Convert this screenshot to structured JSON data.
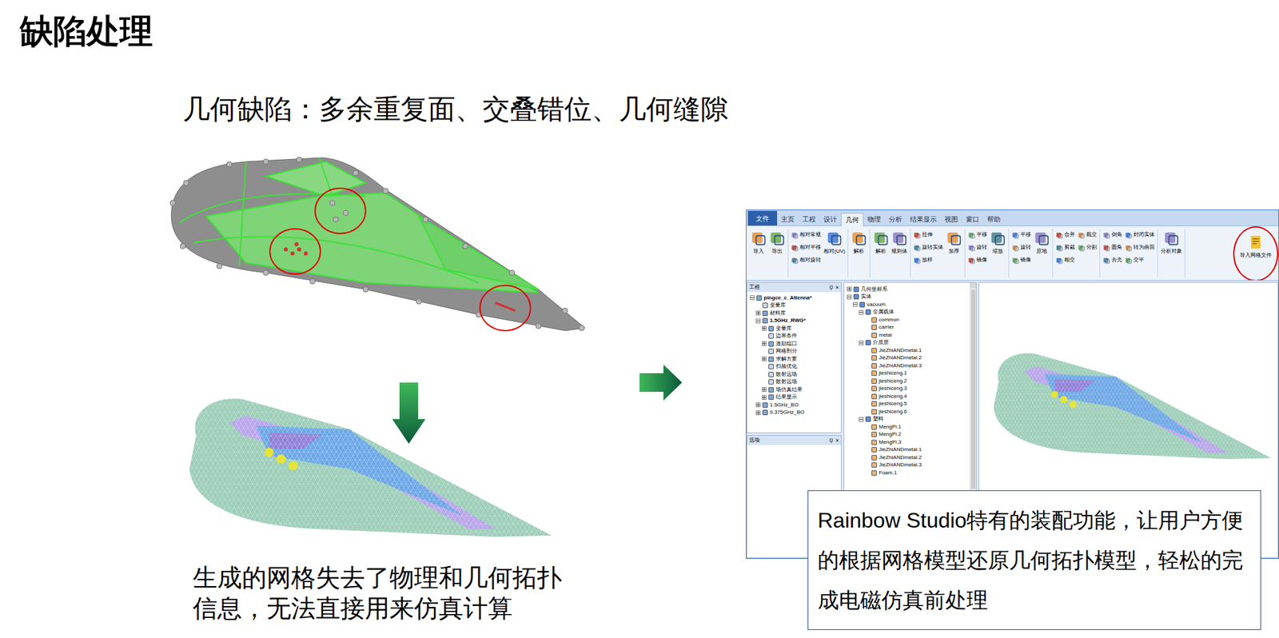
{
  "slide": {
    "title": "缺陷处理",
    "subtitle": "几何缺陷：多余重复面、交叠错位、几何缝隙",
    "caption_lines": [
      "生成的网格失去了物理和几何拓扑",
      "信息，无法直接用来仿真计算"
    ],
    "callout": "Rainbow Studio特有的装配功能，让用户方便的根据网格模型还原几何拓扑模型，轻松的完成电磁仿真前处理"
  },
  "app": {
    "tabs": [
      {
        "label": "文件",
        "kind": "file",
        "selected": false
      },
      {
        "label": "主页",
        "kind": "tab",
        "selected": false
      },
      {
        "label": "工程",
        "kind": "tab",
        "selected": false
      },
      {
        "label": "设计",
        "kind": "tab",
        "selected": false
      },
      {
        "label": "几何",
        "kind": "tab",
        "selected": true
      },
      {
        "label": "物理",
        "kind": "tab",
        "selected": false
      },
      {
        "label": "分析",
        "kind": "tab",
        "selected": false
      },
      {
        "label": "结果显示",
        "kind": "tab",
        "selected": false
      },
      {
        "label": "视图",
        "kind": "tab",
        "selected": false
      },
      {
        "label": "窗口",
        "kind": "tab",
        "selected": false
      },
      {
        "label": "帮助",
        "kind": "tab",
        "selected": false
      }
    ],
    "ribbon": [
      {
        "buttons": [
          {
            "label": "导入",
            "kind": "large"
          },
          {
            "label": "导出",
            "kind": "large"
          }
        ]
      },
      {
        "buttons": [
          {
            "label": "相对常规",
            "kind": "small"
          },
          {
            "label": "相对平移",
            "kind": "small"
          },
          {
            "label": "相对旋转",
            "kind": "small"
          },
          {
            "label": "相对(UV)",
            "kind": "large"
          }
        ]
      },
      {
        "buttons": [
          {
            "label": "解析",
            "kind": "large"
          }
        ]
      },
      {
        "buttons": [
          {
            "label": "解析",
            "kind": "large"
          },
          {
            "label": "规则体",
            "kind": "large"
          }
        ]
      },
      {
        "buttons": [
          {
            "label": "拉伸",
            "kind": "small"
          },
          {
            "label": "旋转实体",
            "kind": "small"
          },
          {
            "label": "放样",
            "kind": "small"
          },
          {
            "label": "加厚",
            "kind": "large"
          }
        ]
      },
      {
        "buttons": [
          {
            "label": "平移",
            "kind": "small"
          },
          {
            "label": "旋转",
            "kind": "small"
          },
          {
            "label": "镜像",
            "kind": "small"
          },
          {
            "label": "缩放",
            "kind": "large"
          }
        ]
      },
      {
        "buttons": [
          {
            "label": "平移",
            "kind": "small"
          },
          {
            "label": "旋转",
            "kind": "small"
          },
          {
            "label": "镜像",
            "kind": "small"
          },
          {
            "label": "原地",
            "kind": "large"
          }
        ]
      },
      {
        "buttons": [
          {
            "label": "合并",
            "kind": "small"
          },
          {
            "label": "剪裁",
            "kind": "small"
          },
          {
            "label": "相交",
            "kind": "small"
          },
          {
            "label": "截交",
            "kind": "small"
          },
          {
            "label": "分割",
            "kind": "small"
          }
        ]
      },
      {
        "buttons": [
          {
            "label": "倒角",
            "kind": "small"
          },
          {
            "label": "圆角",
            "kind": "small"
          },
          {
            "label": "去壳",
            "kind": "small"
          },
          {
            "label": "封闭实体",
            "kind": "small"
          },
          {
            "label": "转为曲面",
            "kind": "small"
          },
          {
            "label": "交平",
            "kind": "small"
          }
        ]
      },
      {
        "buttons": [
          {
            "label": "分析对象",
            "kind": "large"
          }
        ]
      }
    ],
    "import_mesh_button": {
      "label": "导入网格文件",
      "circled": true
    },
    "project_panel": {
      "title": "工程",
      "close": "×"
    },
    "options_panel": {
      "title": "选项",
      "close": "×"
    },
    "project_tree": [
      {
        "label": "pingce_c_Attenna*",
        "depth": 0,
        "kind": "folder",
        "expanded": true,
        "active": true
      },
      {
        "label": "变量库",
        "depth": 1,
        "kind": "leaf",
        "expanded": false,
        "active": false
      },
      {
        "label": "材料库",
        "depth": 1,
        "kind": "folder",
        "expanded": false,
        "active": false
      },
      {
        "label": "1.5GHz_RWG*",
        "depth": 1,
        "kind": "folder",
        "expanded": true,
        "active": true
      },
      {
        "label": "变量库",
        "depth": 2,
        "kind": "folder",
        "expanded": false,
        "active": false
      },
      {
        "label": "边界条件",
        "depth": 2,
        "kind": "leaf",
        "expanded": false,
        "active": false
      },
      {
        "label": "激励端口",
        "depth": 2,
        "kind": "folder",
        "expanded": false,
        "active": false
      },
      {
        "label": "网格剖分",
        "depth": 2,
        "kind": "leaf",
        "expanded": false,
        "active": false
      },
      {
        "label": "求解方案",
        "depth": 2,
        "kind": "folder",
        "expanded": false,
        "active": false
      },
      {
        "label": "扫频优化",
        "depth": 2,
        "kind": "leaf",
        "expanded": false,
        "active": false
      },
      {
        "label": "散射远场",
        "depth": 2,
        "kind": "leaf",
        "expanded": false,
        "active": false
      },
      {
        "label": "散射远场",
        "depth": 2,
        "kind": "leaf",
        "expanded": false,
        "active": false
      },
      {
        "label": "场仿真结果",
        "depth": 2,
        "kind": "folder",
        "expanded": false,
        "active": false
      },
      {
        "label": "结果显示",
        "depth": 2,
        "kind": "folder",
        "expanded": false,
        "active": false
      },
      {
        "label": "1.5GHz_BO",
        "depth": 1,
        "kind": "folder",
        "expanded": false,
        "active": false
      },
      {
        "label": "9.375GHz_BO",
        "depth": 1,
        "kind": "folder",
        "expanded": false,
        "active": false
      }
    ],
    "model_tree": [
      {
        "label": "几何坐标系",
        "depth": 0,
        "kind": "folder",
        "expanded": false
      },
      {
        "label": "实体",
        "depth": 0,
        "kind": "folder",
        "expanded": true
      },
      {
        "label": "vacuum",
        "depth": 1,
        "kind": "folder",
        "expanded": true
      },
      {
        "label": "金属载体",
        "depth": 2,
        "kind": "folder",
        "expanded": true
      },
      {
        "label": "common",
        "depth": 3,
        "kind": "leaf",
        "expanded": false
      },
      {
        "label": "carrier",
        "depth": 3,
        "kind": "leaf",
        "expanded": false
      },
      {
        "label": "metal",
        "depth": 3,
        "kind": "leaf",
        "expanded": false
      },
      {
        "label": "介质层",
        "depth": 2,
        "kind": "folder",
        "expanded": true
      },
      {
        "label": "JieZhiANDmetal.1",
        "depth": 3,
        "kind": "leaf",
        "expanded": false
      },
      {
        "label": "JieZhiANDmetal.2",
        "depth": 3,
        "kind": "leaf",
        "expanded": false
      },
      {
        "label": "JieZhiANDmetal.3",
        "depth": 3,
        "kind": "leaf",
        "expanded": false
      },
      {
        "label": "jieshiceng.1",
        "depth": 3,
        "kind": "leaf",
        "expanded": false
      },
      {
        "label": "jieshiceng.2",
        "depth": 3,
        "kind": "leaf",
        "expanded": false
      },
      {
        "label": "jieshiceng.3",
        "depth": 3,
        "kind": "leaf",
        "expanded": false
      },
      {
        "label": "jieshiceng.4",
        "depth": 3,
        "kind": "leaf",
        "expanded": false
      },
      {
        "label": "jieshiceng.5",
        "depth": 3,
        "kind": "leaf",
        "expanded": false
      },
      {
        "label": "jieshiceng.6",
        "depth": 3,
        "kind": "leaf",
        "expanded": false
      },
      {
        "label": "塑料",
        "depth": 2,
        "kind": "folder",
        "expanded": true
      },
      {
        "label": "MengPi.1",
        "depth": 3,
        "kind": "leaf",
        "expanded": false
      },
      {
        "label": "MengPi.2",
        "depth": 3,
        "kind": "leaf",
        "expanded": false
      },
      {
        "label": "MengPi.3",
        "depth": 3,
        "kind": "leaf",
        "expanded": false
      },
      {
        "label": "JieZhiANDmetal.1",
        "depth": 3,
        "kind": "leaf",
        "expanded": false
      },
      {
        "label": "JieZhiANDmetal.2",
        "depth": 3,
        "kind": "leaf",
        "expanded": false
      },
      {
        "label": "JieZhiANDmetal.3",
        "depth": 3,
        "kind": "leaf",
        "expanded": false
      },
      {
        "label": "Foam.1",
        "depth": 3,
        "kind": "leaf",
        "expanded": false
      }
    ]
  }
}
